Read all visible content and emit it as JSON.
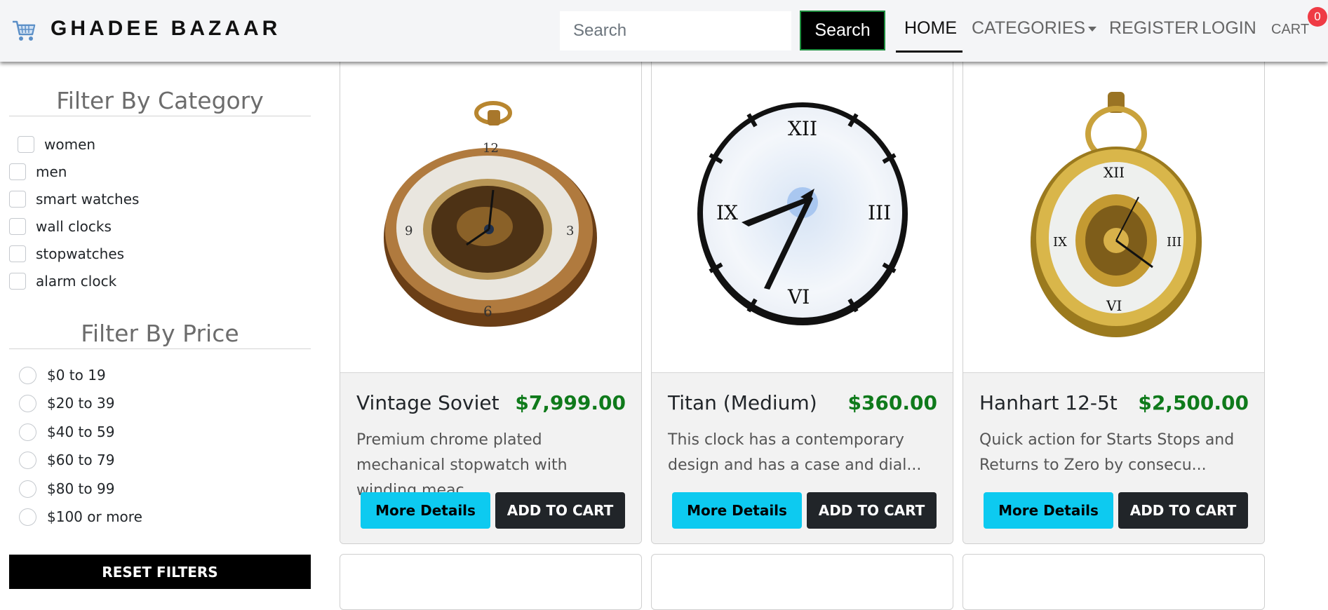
{
  "navbar": {
    "brand_icon": "shopping-cart-icon",
    "brand_name": "GHADEE BAZAAR",
    "search_placeholder": "Search",
    "search_button": "Search",
    "links": {
      "home": "HOME",
      "categories": "CATEGORIES",
      "register": "REGISTER",
      "login": "LOGIN",
      "cart": "CART"
    },
    "cart_count": "0",
    "badge_color": "#ef3b45"
  },
  "sidebar": {
    "category_title": "Filter By Category",
    "categories": [
      "women",
      "men",
      "smart watches",
      "wall clocks",
      "stopwatches",
      "alarm clock"
    ],
    "price_title": "Filter By Price",
    "price_ranges": [
      "$0 to 19",
      "$20 to 39",
      "$40 to 59",
      "$60 to 79",
      "$80 to 99",
      "$100 or more"
    ],
    "reset_button": "RESET FILTERS"
  },
  "products": [
    {
      "image": "vintage-pocket-watch-image",
      "title": "Vintage Soviet",
      "price": "$7,999.00",
      "description": "Premium chrome plated mechanical stopwatch with winding meac...",
      "details_button": "More Details",
      "cart_button": "ADD TO CART"
    },
    {
      "image": "wall-clock-image",
      "title": "Titan (Medium)",
      "price": "$360.00",
      "description": "This clock has a contemporary design and has a case and dial...",
      "details_button": "More Details",
      "cart_button": "ADD TO CART"
    },
    {
      "image": "gold-skeleton-pocket-watch-image",
      "title": "Hanhart 12-5t",
      "price": "$2,500.00",
      "description": "Quick action for Starts Stops and Returns to Zero by consecu...",
      "details_button": "More Details",
      "cart_button": "ADD TO CART"
    }
  ],
  "colors": {
    "price": "#0f7a1b",
    "details_button": "#0dcaf0",
    "cart_button": "#212529",
    "reset_button": "#000000"
  }
}
